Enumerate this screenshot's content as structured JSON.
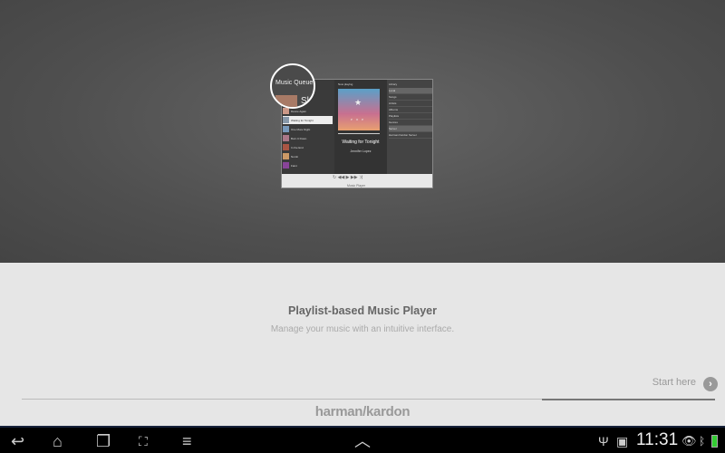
{
  "preview": {
    "lens_title": "Music Queue",
    "lens_text": "Sk",
    "now_playing_header": "Now playing",
    "library_header": "Library",
    "album_genre": "POP",
    "song_title": "Waiting for Tonight",
    "song_artist": "Jennifer Lopez",
    "queue": [
      "Dance Again",
      "Waiting for Tonight",
      "One More Night",
      "Burn It Down",
      "In the End",
      "Numb",
      "Faint"
    ],
    "library_items": [
      "Local",
      "Songs",
      "Artists",
      "Albums",
      "Playlists",
      "Genres",
      "Server",
      "Harman Kardon Server"
    ],
    "footer_label": "Music Player"
  },
  "intro": {
    "heading": "Playlist-based Music Player",
    "subtitle": "Manage your music with an intuitive interface.",
    "start_label": "Start here",
    "brand": "harman/kardon",
    "progress_percent": 25
  },
  "statusbar": {
    "time": "11:31"
  }
}
